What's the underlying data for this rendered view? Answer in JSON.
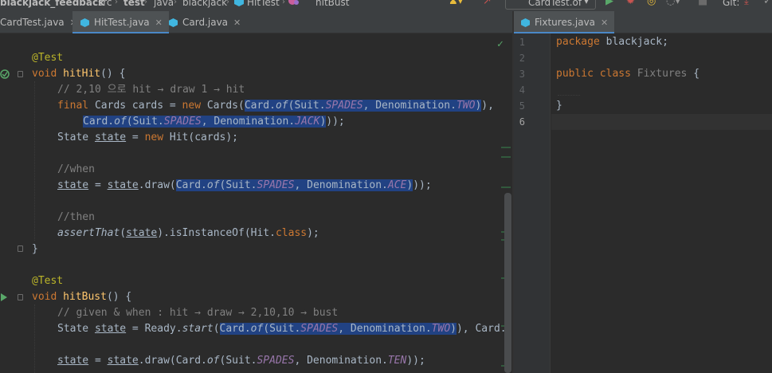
{
  "navbar": {
    "project": "blackjack_feedback",
    "src": "src",
    "test": "test",
    "java": "java",
    "pkg": "blackjack",
    "file": "HitTest",
    "method": "hitBust",
    "run_config": "CardTest.of",
    "git_label": "Git:"
  },
  "left_tabs": [
    {
      "label": "CardTest.java",
      "active": false
    },
    {
      "label": "HitTest.java",
      "active": true
    },
    {
      "label": "Card.java",
      "active": false
    }
  ],
  "right_tabs": [
    {
      "label": "Fixtures.java",
      "active": true
    }
  ],
  "colors": {
    "keyword": "#cc7832",
    "annotation": "#bbb529",
    "method": "#ffc66d",
    "comment": "#808080",
    "static_field": "#9876aa",
    "selection": "#214283",
    "tab_underline": "#4a88c7"
  },
  "left_code": {
    "l1_ann": "@Test",
    "l2_void": "void",
    "l2_name": "hitHit",
    "l2_rest": "() {",
    "l3_comment": "// 2,10 으로 hit → draw 1 → hit",
    "l4_final": "final",
    "l4_a": " Cards cards = ",
    "l4_new": "new",
    "l4_b": " Cards(",
    "l4_card": "Card.",
    "l4_of": "of",
    "l4_suit": "(Suit.",
    "l4_spades": "SPADES",
    "l4_denom": ", Denomination.",
    "l4_two": "TWO",
    "l4_end": "),",
    "l5_card": "Card.",
    "l5_of": "of",
    "l5_suit": "(Suit.",
    "l5_spades": "SPADES",
    "l5_denom": ", Denomination.",
    "l5_jack": "JACK",
    "l5_end": "));",
    "l6_a": "State ",
    "l6_state": "state",
    "l6_b": " = ",
    "l6_new": "new",
    "l6_c": " Hit(cards);",
    "l8_comment": "//when",
    "l9_state1": "state",
    "l9_a": " = ",
    "l9_state2": "state",
    "l9_b": ".draw(",
    "l9_card": "Card.",
    "l9_of": "of",
    "l9_suit": "(Suit.",
    "l9_spades": "SPADES",
    "l9_denom": ", Denomination.",
    "l9_ace": "ACE",
    "l9_end": "));",
    "l11_comment": "//then",
    "l12_assert": "assertThat",
    "l12_a": "(",
    "l12_state": "state",
    "l12_b": ").isInstanceOf(Hit.",
    "l12_class": "class",
    "l12_c": ");",
    "l13_brace": "}",
    "l15_ann": "@Test",
    "l16_void": "void",
    "l16_name": "hitBust",
    "l16_rest": "() {",
    "l17_comment": "// given & when : hit → draw → 2,10,10 → bust",
    "l18_a": "State ",
    "l18_state": "state",
    "l18_b": " = Ready.",
    "l18_start": "start",
    "l18_c": "(",
    "l18_card": "Card.",
    "l18_of": "of",
    "l18_suit": "(Suit.",
    "l18_spades": "SPADES",
    "l18_denom": ", Denomination.",
    "l18_two": "TWO",
    "l18_end": "), Card.",
    "l20_state1": "state",
    "l20_a": " = ",
    "l20_state2": "state",
    "l20_b": ".draw(Card.",
    "l20_of": "of",
    "l20_suit": "(Suit.",
    "l20_spades": "SPADES",
    "l20_denom": ", Denomination.",
    "l20_ten": "TEN",
    "l20_end": "));"
  },
  "right_code": {
    "line_numbers": [
      "1",
      "2",
      "3",
      "4",
      "5",
      "6"
    ],
    "l1_package": "package",
    "l1_name": " blackjack;",
    "l3_public": "public",
    "l3_class": " class",
    "l3_name": " Fixtures",
    "l3_brace": " {",
    "l5_brace": "}"
  }
}
